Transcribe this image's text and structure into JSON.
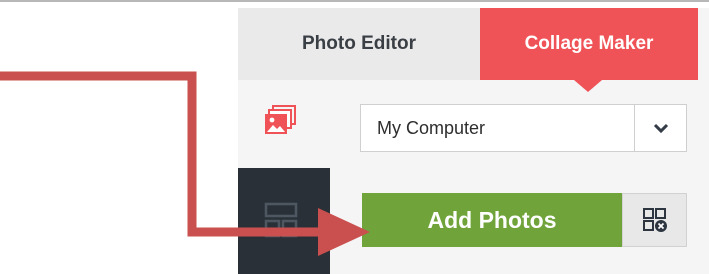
{
  "tabs": [
    {
      "label": "Photo Editor"
    },
    {
      "label": "Collage Maker",
      "active": true
    }
  ],
  "source_select": {
    "value": "My Computer"
  },
  "buttons": {
    "add_photos": "Add Photos"
  },
  "icons": {
    "photos": "stacked-photos-icon",
    "layout": "layout-grid-icon",
    "dropdown": "chevron-down-icon",
    "remove": "grid-remove-icon",
    "annotation": "annotation-arrow"
  },
  "colors": {
    "accent": "#ef5357",
    "add_button": "#70a33a",
    "sidebar": "#2a3038",
    "arrow": "#c9504f"
  }
}
